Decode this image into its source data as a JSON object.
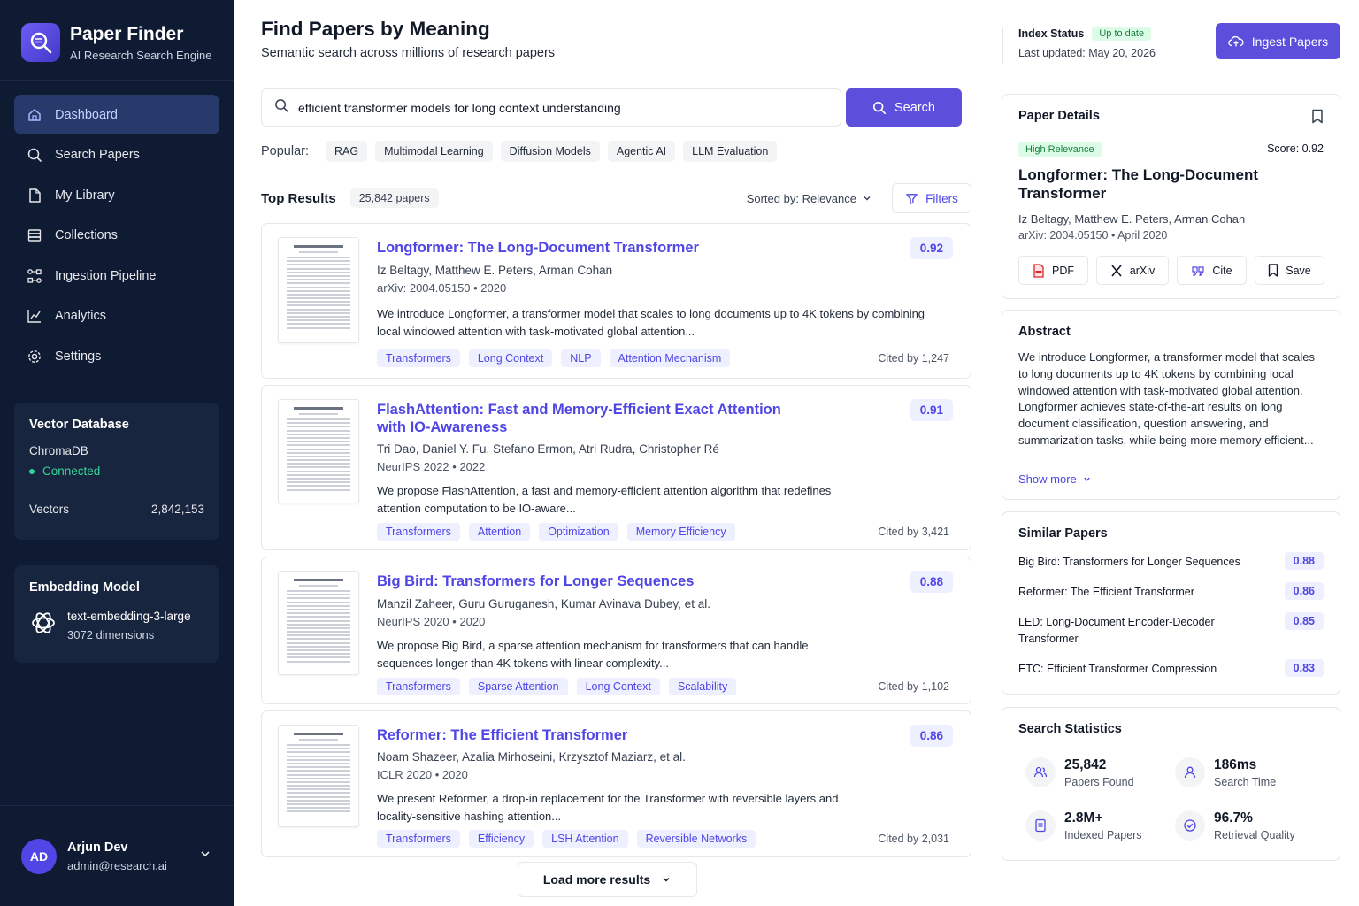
{
  "brand": {
    "title": "Paper Finder",
    "subtitle": "AI Research Search Engine"
  },
  "nav": [
    {
      "label": "Dashboard",
      "icon": "home-icon",
      "active": true
    },
    {
      "label": "Search Papers",
      "icon": "search-icon"
    },
    {
      "label": "My Library",
      "icon": "file-icon"
    },
    {
      "label": "Collections",
      "icon": "database-icon"
    },
    {
      "label": "Ingestion Pipeline",
      "icon": "pipeline-icon"
    },
    {
      "label": "Analytics",
      "icon": "chart-icon"
    },
    {
      "label": "Settings",
      "icon": "gear-icon"
    }
  ],
  "vector_db": {
    "title": "Vector Database",
    "name": "ChromaDB",
    "status": "Connected",
    "vectors_label": "Vectors",
    "vectors_value": "2,842,153"
  },
  "embedding": {
    "title": "Embedding Model",
    "name": "text-embedding-3-large",
    "dims": "3072 dimensions"
  },
  "user": {
    "initials": "AD",
    "name": "Arjun Dev",
    "email": "admin@research.ai"
  },
  "header": {
    "title": "Find Papers by Meaning",
    "subtitle": "Semantic search across millions of research papers"
  },
  "search": {
    "value": "efficient transformer models for long context understanding",
    "button": "Search"
  },
  "popular": {
    "label": "Popular:",
    "chips": [
      "RAG",
      "Multimodal Learning",
      "Diffusion Models",
      "Agentic AI",
      "LLM Evaluation"
    ]
  },
  "results": {
    "title": "Top Results",
    "count": "25,842 papers",
    "sort": "Sorted by: Relevance",
    "filters": "Filters",
    "load_more": "Load more results"
  },
  "papers": [
    {
      "title": "Longformer: The Long-Document Transformer",
      "score": "0.92",
      "authors": "Iz Beltagy, Matthew E. Peters, Arman Cohan",
      "venue": "arXiv: 2004.05150  •  2020",
      "abstract": "We introduce Longformer, a transformer model that scales to long documents up to 4K tokens by combining local windowed attention with task-motivated global attention...",
      "tags": [
        "Transformers",
        "Long Context",
        "NLP",
        "Attention Mechanism"
      ],
      "cited": "Cited by 1,247"
    },
    {
      "title": "FlashAttention: Fast and Memory-Efficient Exact Attention with IO-Awareness",
      "score": "0.91",
      "authors": "Tri Dao, Daniel Y. Fu, Stefano Ermon, Atri Rudra, Christopher Ré",
      "venue": "NeurIPS 2022  •  2022",
      "abstract": "We propose FlashAttention, a fast and memory-efficient attention algorithm that redefines attention computation to be IO-aware...",
      "tags": [
        "Transformers",
        "Attention",
        "Optimization",
        "Memory Efficiency"
      ],
      "cited": "Cited by 3,421"
    },
    {
      "title": "Big Bird: Transformers for Longer Sequences",
      "score": "0.88",
      "authors": "Manzil Zaheer, Guru Guruganesh, Kumar Avinava Dubey, et al.",
      "venue": "NeurIPS 2020  •  2020",
      "abstract": "We propose Big Bird, a sparse attention mechanism for transformers that can handle sequences longer than 4K tokens with linear complexity...",
      "tags": [
        "Transformers",
        "Sparse Attention",
        "Long Context",
        "Scalability"
      ],
      "cited": "Cited by 1,102"
    },
    {
      "title": "Reformer: The Efficient Transformer",
      "score": "0.86",
      "authors": "Noam Shazeer, Azalia Mirhoseini, Krzysztof Maziarz, et al.",
      "venue": "ICLR 2020  •  2020",
      "abstract": "We present Reformer, a drop-in replacement for the Transformer with reversible layers and locality-sensitive hashing attention...",
      "tags": [
        "Transformers",
        "Efficiency",
        "LSH Attention",
        "Reversible Networks"
      ],
      "cited": "Cited by 2,031"
    }
  ],
  "index": {
    "label": "Index Status",
    "badge": "Up to date",
    "updated": "Last updated: May 20, 2026",
    "ingest": "Ingest Papers"
  },
  "details": {
    "heading": "Paper Details",
    "badge": "High Relevance",
    "score": "Score: 0.92",
    "title": "Longformer: The Long-Document Transformer",
    "authors": "Iz Beltagy, Matthew E. Peters, Arman Cohan",
    "venue": "arXiv: 2004.05150  •  April 2020",
    "buttons": [
      "PDF",
      "arXiv",
      "Cite",
      "Save"
    ]
  },
  "abstract_panel": {
    "heading": "Abstract",
    "text": "We introduce Longformer, a transformer model that scales to long documents up to 4K tokens by combining local windowed attention with task-motivated global attention. Longformer achieves state-of-the-art results on long document classification, question answering, and summarization tasks, while being more memory efficient...",
    "show_more": "Show more"
  },
  "similar": {
    "heading": "Similar Papers",
    "items": [
      {
        "title": "Big Bird: Transformers for Longer Sequences",
        "score": "0.88"
      },
      {
        "title": "Reformer: The Efficient Transformer",
        "score": "0.86"
      },
      {
        "title": "LED: Long-Document Encoder-Decoder Transformer",
        "score": "0.85"
      },
      {
        "title": "ETC: Efficient Transformer Compression",
        "score": "0.83"
      }
    ]
  },
  "stats": {
    "heading": "Search Statistics",
    "items": [
      {
        "value": "25,842",
        "label": "Papers Found",
        "icon": "users-icon"
      },
      {
        "value": "186ms",
        "label": "Search Time",
        "icon": "user-icon"
      },
      {
        "value": "2.8M+",
        "label": "Indexed Papers",
        "icon": "document-icon"
      },
      {
        "value": "96.7%",
        "label": "Retrieval Quality",
        "icon": "check-circle-icon"
      }
    ]
  },
  "colors": {
    "sidebar": "#0f1a33",
    "accent": "#5b4fdc",
    "success": "#15803d"
  }
}
